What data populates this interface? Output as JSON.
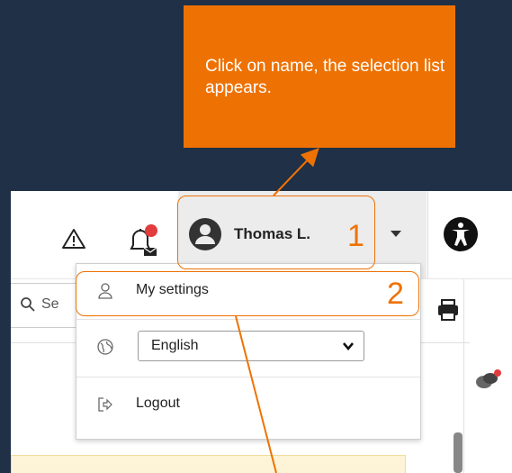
{
  "callout": {
    "text": "Click on name, the selection list appears."
  },
  "header": {
    "user_name": "Thomas L.",
    "notification_badge_color": "#e23c3c",
    "warning_icon": "warning-triangle-icon",
    "bell_icon": "bell-icon",
    "accessibility_icon": "accessibility-icon"
  },
  "search": {
    "text": "Se"
  },
  "menu": {
    "settings_label": "My settings",
    "language_value": "English",
    "logout_label": "Logout"
  },
  "steps": {
    "step1": "1",
    "step2": "2"
  },
  "colors": {
    "accent": "#ee7203",
    "background": "#1f3047"
  }
}
